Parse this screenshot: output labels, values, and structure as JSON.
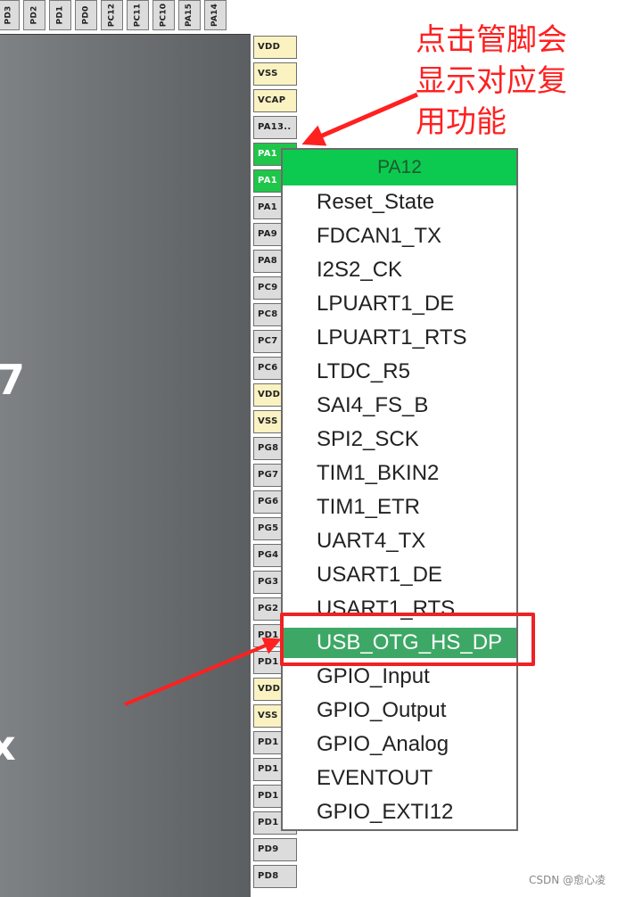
{
  "chip": {
    "marks": [
      "7",
      "x"
    ]
  },
  "top_pins": [
    "PD3",
    "PD2",
    "PD1",
    "PD0",
    "PC12",
    "PC11",
    "PC10",
    "PA15",
    "PA14"
  ],
  "right_pins": [
    {
      "label": "VDD",
      "type": "power"
    },
    {
      "label": "VSS",
      "type": "power"
    },
    {
      "label": "VCAP",
      "type": "power"
    },
    {
      "label": "PA13..",
      "type": "io"
    },
    {
      "label": "PA1",
      "type": "active"
    },
    {
      "label": "PA1",
      "type": "active"
    },
    {
      "label": "PA1",
      "type": "io"
    },
    {
      "label": "PA9",
      "type": "io"
    },
    {
      "label": "PA8",
      "type": "io"
    },
    {
      "label": "PC9",
      "type": "io"
    },
    {
      "label": "PC8",
      "type": "io"
    },
    {
      "label": "PC7",
      "type": "io"
    },
    {
      "label": "PC6",
      "type": "io"
    },
    {
      "label": "VDD",
      "type": "power"
    },
    {
      "label": "VSS",
      "type": "power"
    },
    {
      "label": "PG8",
      "type": "io"
    },
    {
      "label": "PG7",
      "type": "io"
    },
    {
      "label": "PG6",
      "type": "io"
    },
    {
      "label": "PG5",
      "type": "io"
    },
    {
      "label": "PG4",
      "type": "io"
    },
    {
      "label": "PG3",
      "type": "io"
    },
    {
      "label": "PG2",
      "type": "io"
    },
    {
      "label": "PD1",
      "type": "io"
    },
    {
      "label": "PD1",
      "type": "io"
    },
    {
      "label": "VDD",
      "type": "power"
    },
    {
      "label": "VSS",
      "type": "power"
    },
    {
      "label": "PD1",
      "type": "io"
    },
    {
      "label": "PD1",
      "type": "io"
    },
    {
      "label": "PD1",
      "type": "io"
    },
    {
      "label": "PD1",
      "type": "io"
    },
    {
      "label": "PD9",
      "type": "io"
    },
    {
      "label": "PD8",
      "type": "io"
    }
  ],
  "popup": {
    "title": "PA12",
    "items": [
      "Reset_State",
      "FDCAN1_TX",
      "I2S2_CK",
      "LPUART1_DE",
      "LPUART1_RTS",
      "LTDC_R5",
      "SAI4_FS_B",
      "SPI2_SCK",
      "TIM1_BKIN2",
      "TIM1_ETR",
      "UART4_TX",
      "USART1_DE",
      "USART1_RTS",
      "USB_OTG_HS_DP",
      "GPIO_Input",
      "GPIO_Output",
      "GPIO_Analog",
      "EVENTOUT",
      "GPIO_EXTI12"
    ],
    "selected_index": 13
  },
  "annotation": {
    "lines": [
      "点击管脚会",
      "显示对应复",
      "用功能"
    ]
  },
  "colors": {
    "annotation": "#ff2020",
    "selected_item": "#3da865",
    "popup_header": "#0cc950",
    "active_pin": "#1fc649",
    "power_pin": "#fbf2c2"
  },
  "watermark": "CSDN @愈心凌"
}
